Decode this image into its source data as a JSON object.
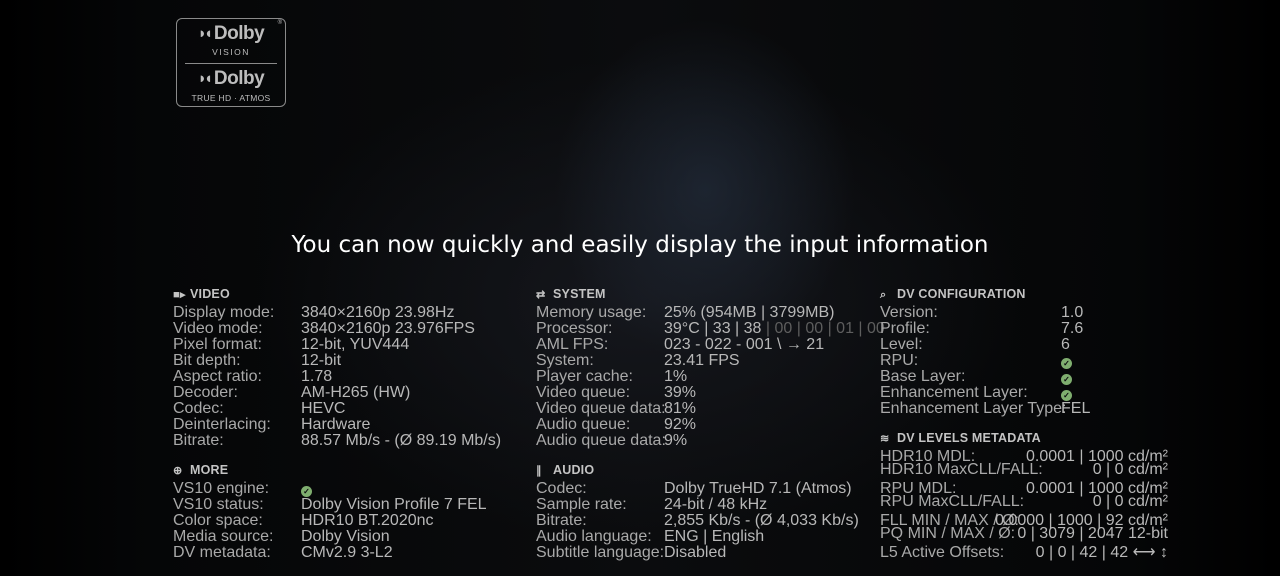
{
  "logo": {
    "brand_top": "Dolby",
    "sub_top": "VISION",
    "brand_bottom": "Dolby",
    "sub_bottom": "TRUE HD · ATMOS"
  },
  "headline": "You can now quickly and easily display the input information",
  "video": {
    "title": "VIDEO",
    "rows": [
      {
        "k": "Display mode:",
        "v": "3840×2160p 23.98Hz"
      },
      {
        "k": "Video mode:",
        "v": "3840×2160p 23.976FPS"
      },
      {
        "k": "Pixel format:",
        "v": "12-bit, YUV444"
      },
      {
        "k": "Bit depth:",
        "v": "12-bit"
      },
      {
        "k": "Aspect ratio:",
        "v": "1.78"
      },
      {
        "k": "Decoder:",
        "v": "AM-H265 (HW)"
      },
      {
        "k": "Codec:",
        "v": "HEVC"
      },
      {
        "k": "Deinterlacing:",
        "v": "Hardware"
      },
      {
        "k": "Bitrate:",
        "v": "88.57 Mb/s - (Ø 89.19 Mb/s)"
      }
    ]
  },
  "more": {
    "title": "MORE",
    "rows": [
      {
        "k": "VS10 engine:",
        "v": ""
      },
      {
        "k": "VS10 status:",
        "v": "Dolby Vision Profile 7 FEL"
      },
      {
        "k": "Color space:",
        "v": "HDR10 BT.2020nc"
      },
      {
        "k": "Media source:",
        "v": "Dolby Vision"
      },
      {
        "k": "DV metadata:",
        "v": "CMv2.9 3-L2"
      }
    ]
  },
  "system": {
    "title": "SYSTEM",
    "rows": [
      {
        "k": "Memory usage:",
        "v": "25% (954MB | 3799MB)"
      },
      {
        "k": "Processor:",
        "v": "39°C | 33 | 38",
        "dim": " | 00 | 00 | 01 | 00"
      },
      {
        "k": "AML FPS:",
        "v": "023 - 022 - 001 \\  → 21"
      },
      {
        "k": "System:",
        "v": "23.41 FPS"
      },
      {
        "k": "Player cache:",
        "v": "1%"
      },
      {
        "k": "Video queue:",
        "v": "39%"
      },
      {
        "k": "Video queue data:",
        "v": "81%"
      },
      {
        "k": "Audio queue:",
        "v": "92%"
      },
      {
        "k": "Audio queue data:",
        "v": "9%"
      }
    ]
  },
  "audio": {
    "title": "AUDIO",
    "rows": [
      {
        "k": "Codec:",
        "v": "Dolby TrueHD 7.1 (Atmos)"
      },
      {
        "k": "Sample rate:",
        "v": "24-bit / 48 kHz"
      },
      {
        "k": "Bitrate:",
        "v": "2,855 Kb/s - (Ø 4,033 Kb/s)"
      },
      {
        "k": "Audio language:",
        "v": "ENG | English"
      },
      {
        "k": "Subtitle language:",
        "v": "Disabled"
      }
    ]
  },
  "dvconfig": {
    "title": "DV CONFIGURATION",
    "rows": [
      {
        "k": "Version:",
        "v": "1.0"
      },
      {
        "k": "Profile:",
        "v": "7.6"
      },
      {
        "k": "Level:",
        "v": "6"
      },
      {
        "k": "RPU:",
        "v": ""
      },
      {
        "k": "Base Layer:",
        "v": ""
      },
      {
        "k": "Enhancement Layer:",
        "v": ""
      },
      {
        "k": "Enhancement Layer Type:",
        "v": "FEL"
      }
    ]
  },
  "dvlevels": {
    "title": "DV LEVELS METADATA",
    "rows": [
      {
        "k": "HDR10 MDL:",
        "v": "0.0001 | 1000  cd/m²"
      },
      {
        "k": "HDR10 MaxCLL/FALL:",
        "v": "0 | 0  cd/m²"
      },
      {
        "k": "RPU MDL:",
        "v": "0.0001 | 1000  cd/m²"
      },
      {
        "k": "RPU MaxCLL/FALL:",
        "v": "0 | 0  cd/m²"
      },
      {
        "k": "FLL MIN / MAX / Ø:",
        "v": "0.0000 | 1000 | 92  cd/m²"
      },
      {
        "k": "PQ  MIN / MAX / Ø:",
        "v": "0 | 3079 | 2047  12-bit"
      },
      {
        "k": "L5 Active Offsets:",
        "v": "0 | 0 | 42 | 42  ⟷ ↕"
      }
    ]
  }
}
